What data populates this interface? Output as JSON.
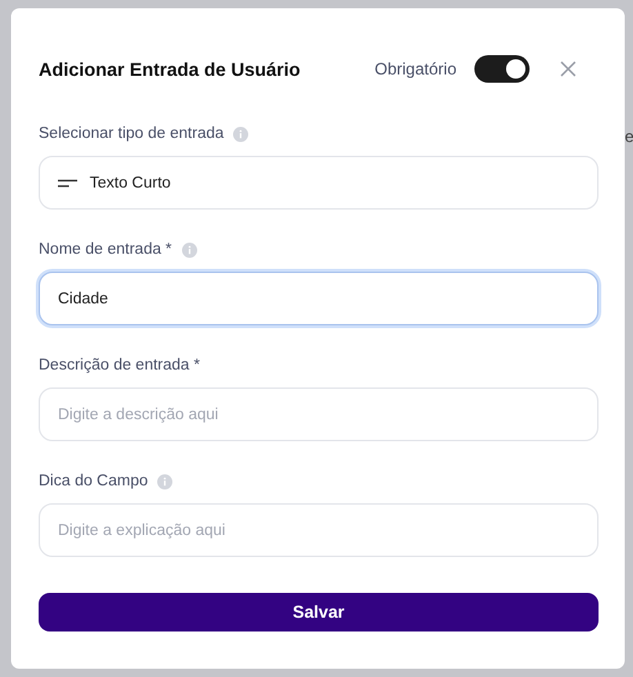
{
  "backdrop": {
    "text_fragment": "e"
  },
  "dialog": {
    "title": "Adicionar Entrada de Usuário",
    "required_toggle": {
      "label": "Obrigatório",
      "on": true
    },
    "fields": [
      {
        "kind": "select",
        "label": "Selecionar tipo de entrada",
        "info": true,
        "value": "Texto Curto",
        "focused": false
      },
      {
        "kind": "text",
        "label": "Nome de entrada *",
        "info": true,
        "value": "Cidade",
        "focused": true
      },
      {
        "kind": "text",
        "label": "Descrição de entrada *",
        "info": false,
        "placeholder": "Digite a descrição aqui",
        "focused": false
      },
      {
        "kind": "text",
        "label": "Dica do Campo",
        "info": true,
        "placeholder": "Digite a explicação aqui",
        "focused": false
      }
    ],
    "save_button": "Salvar"
  }
}
